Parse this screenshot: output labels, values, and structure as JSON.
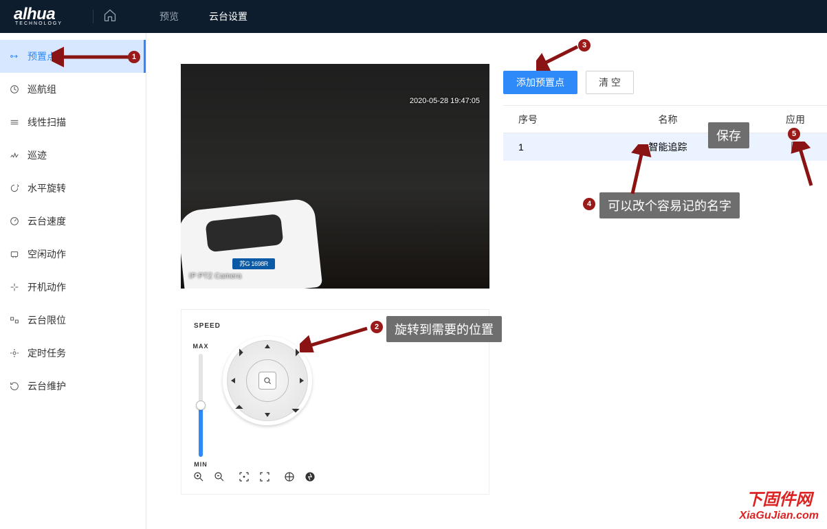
{
  "header": {
    "brand": "alhua",
    "brand_sub": "TECHNOLOGY",
    "nav": {
      "preview": "预览",
      "ptz": "云台设置"
    }
  },
  "sidebar": {
    "items": [
      {
        "label": "预置点"
      },
      {
        "label": "巡航组"
      },
      {
        "label": "线性扫描"
      },
      {
        "label": "巡迹"
      },
      {
        "label": "水平旋转"
      },
      {
        "label": "云台速度"
      },
      {
        "label": "空闲动作"
      },
      {
        "label": "开机动作"
      },
      {
        "label": "云台限位"
      },
      {
        "label": "定时任务"
      },
      {
        "label": "云台维护"
      }
    ]
  },
  "video": {
    "timestamp": "2020-05-28 19:47:05",
    "plate": "苏G 1698R",
    "camera_label": "IP PTZ Camera"
  },
  "buttons": {
    "add_preset": "添加预置点",
    "clear": "清 空"
  },
  "table": {
    "col_no": "序号",
    "col_name": "名称",
    "col_action": "应用",
    "rows": [
      {
        "no": "1",
        "name": "智能追踪"
      }
    ]
  },
  "ptz": {
    "speed": "SPEED",
    "max": "MAX",
    "min": "MIN"
  },
  "annotations": {
    "b1": "1",
    "b2": "2",
    "b3": "3",
    "b4": "4",
    "b5": "5",
    "tip2": "旋转到需要的位置",
    "tip4": "可以改个容易记的名字",
    "tip_save": "保存"
  },
  "watermark": {
    "cn": "下固件网",
    "en": "XiaGuJian.com"
  }
}
